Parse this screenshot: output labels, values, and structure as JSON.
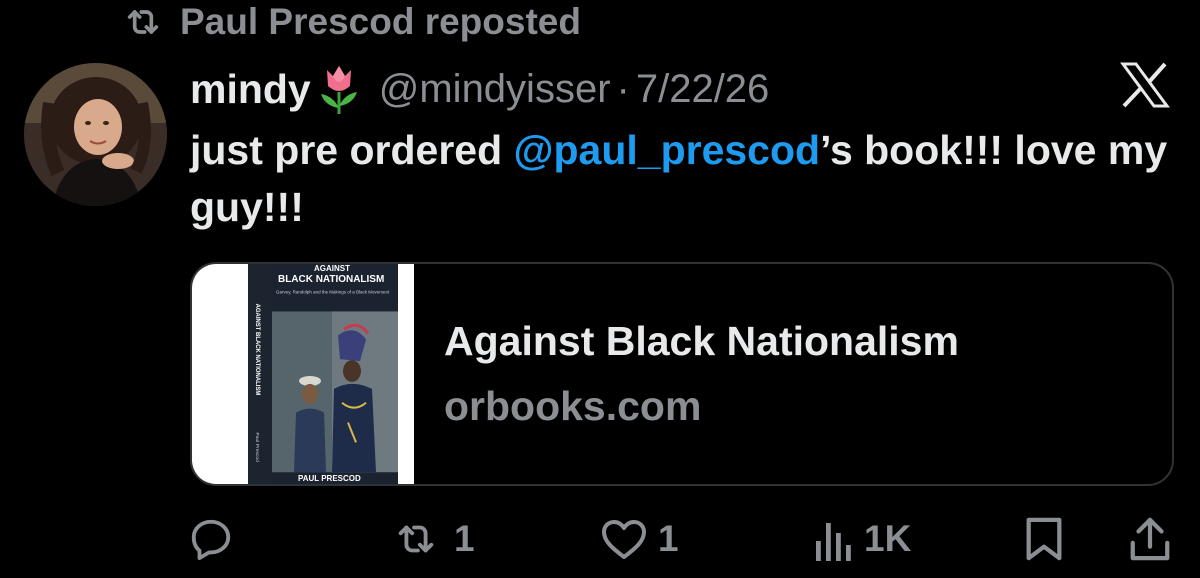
{
  "repost": {
    "icon": "repost-icon",
    "text": "Paul Prescod reposted"
  },
  "tweet": {
    "display_name": "mindy",
    "name_emoji": "tulip-icon",
    "handle": "@mindyisser",
    "separator": "·",
    "date": "7/22/26",
    "text_parts": {
      "before": "just pre ordered ",
      "mention": "@paul_prescod",
      "after": "’s book!!! love my guy!!!"
    }
  },
  "card": {
    "title": "Against Black Nationalism",
    "domain": "orbooks.com",
    "thumbnail": {
      "top_text": "AGAINST",
      "title_text": "BLACK NATIONALISM",
      "subtitle_text": "Garvey, Randolph and the Makings of a Black Movement",
      "spine_text": "AGAINST BLACK NATIONALISM",
      "spine_author": "Paul Prescod",
      "author_text": "PAUL PRESCOD"
    }
  },
  "actions": {
    "reply": {
      "icon": "reply-icon",
      "count": ""
    },
    "repost": {
      "icon": "repost-icon",
      "count": "1"
    },
    "like": {
      "icon": "heart-icon",
      "count": "1"
    },
    "views": {
      "icon": "views-icon",
      "count": "1K"
    },
    "bookmark": {
      "icon": "bookmark-icon"
    },
    "share": {
      "icon": "share-icon"
    }
  },
  "colors": {
    "background": "#000000",
    "text": "#e7e9ea",
    "muted": "#8b8f94",
    "mention": "#1d9bf0",
    "border": "#2f3336"
  }
}
